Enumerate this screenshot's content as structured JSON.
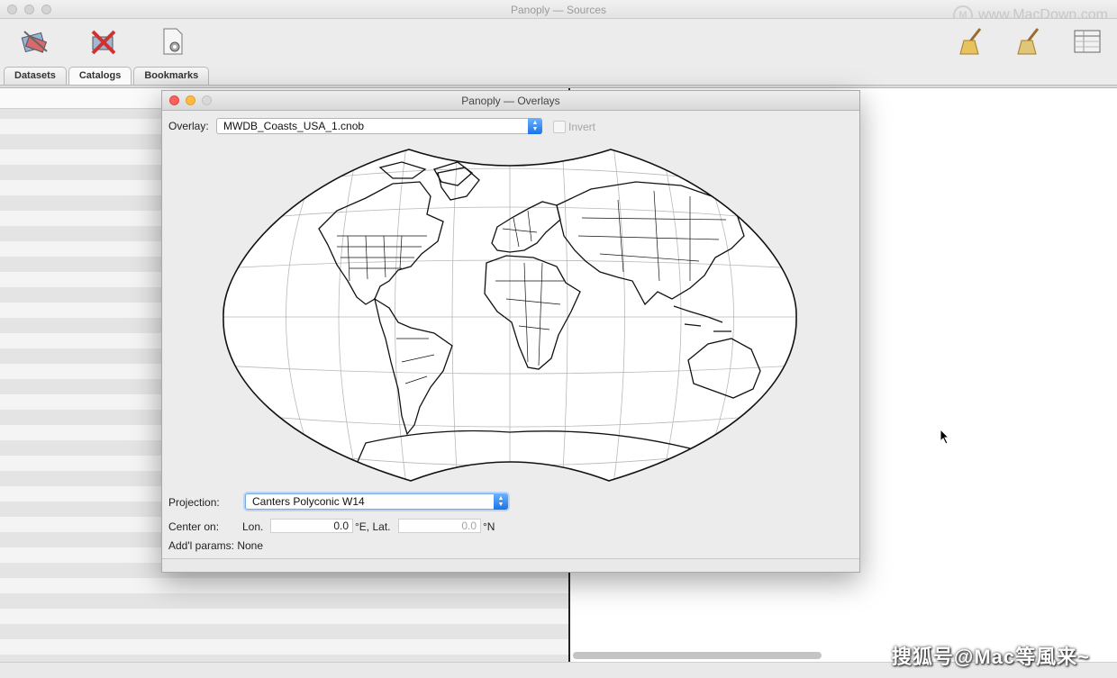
{
  "window": {
    "title": "Panoply — Sources",
    "watermark": "www.MacDown.com",
    "watermark_logo": "M"
  },
  "toolbar": {
    "icons": [
      "combine-plot-icon",
      "remove-icon",
      "open-file-icon",
      "broom-icon",
      "broom-icon-2",
      "table-view-icon"
    ]
  },
  "tabs": [
    {
      "label": "Datasets"
    },
    {
      "label": "Catalogs"
    },
    {
      "label": "Bookmarks"
    }
  ],
  "dialog": {
    "title": "Panoply — Overlays",
    "overlay_label": "Overlay:",
    "overlay_value": "MWDB_Coasts_USA_1.cnob",
    "invert_label": "Invert",
    "projection_label": "Projection:",
    "projection_value": "Canters Polyconic W14",
    "center_label": "Center on:",
    "lon_label": "Lon.",
    "lon_value": "0.0",
    "lon_unit": "°E, Lat.",
    "lat_value": "0.0",
    "lat_unit": "°N",
    "params_label": "Add'l params:",
    "params_value": "None"
  },
  "bottom_watermark": "搜狐号@Mac等風来~"
}
